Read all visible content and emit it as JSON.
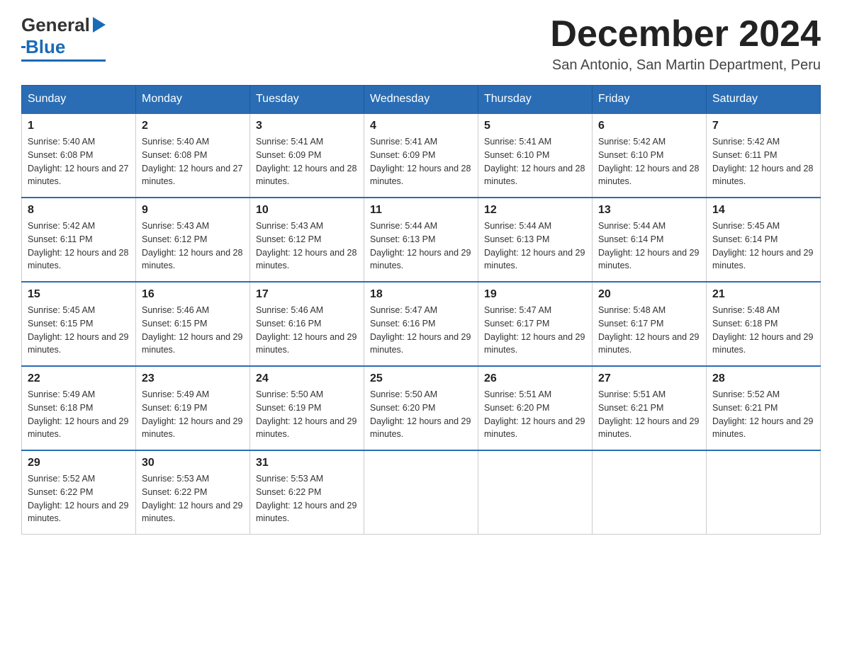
{
  "header": {
    "logo": {
      "general": "General",
      "blue": "Blue"
    },
    "title": "December 2024",
    "location": "San Antonio, San Martin Department, Peru"
  },
  "calendar": {
    "days_of_week": [
      "Sunday",
      "Monday",
      "Tuesday",
      "Wednesday",
      "Thursday",
      "Friday",
      "Saturday"
    ],
    "weeks": [
      [
        {
          "day": "1",
          "sunrise": "Sunrise: 5:40 AM",
          "sunset": "Sunset: 6:08 PM",
          "daylight": "Daylight: 12 hours and 27 minutes."
        },
        {
          "day": "2",
          "sunrise": "Sunrise: 5:40 AM",
          "sunset": "Sunset: 6:08 PM",
          "daylight": "Daylight: 12 hours and 27 minutes."
        },
        {
          "day": "3",
          "sunrise": "Sunrise: 5:41 AM",
          "sunset": "Sunset: 6:09 PM",
          "daylight": "Daylight: 12 hours and 28 minutes."
        },
        {
          "day": "4",
          "sunrise": "Sunrise: 5:41 AM",
          "sunset": "Sunset: 6:09 PM",
          "daylight": "Daylight: 12 hours and 28 minutes."
        },
        {
          "day": "5",
          "sunrise": "Sunrise: 5:41 AM",
          "sunset": "Sunset: 6:10 PM",
          "daylight": "Daylight: 12 hours and 28 minutes."
        },
        {
          "day": "6",
          "sunrise": "Sunrise: 5:42 AM",
          "sunset": "Sunset: 6:10 PM",
          "daylight": "Daylight: 12 hours and 28 minutes."
        },
        {
          "day": "7",
          "sunrise": "Sunrise: 5:42 AM",
          "sunset": "Sunset: 6:11 PM",
          "daylight": "Daylight: 12 hours and 28 minutes."
        }
      ],
      [
        {
          "day": "8",
          "sunrise": "Sunrise: 5:42 AM",
          "sunset": "Sunset: 6:11 PM",
          "daylight": "Daylight: 12 hours and 28 minutes."
        },
        {
          "day": "9",
          "sunrise": "Sunrise: 5:43 AM",
          "sunset": "Sunset: 6:12 PM",
          "daylight": "Daylight: 12 hours and 28 minutes."
        },
        {
          "day": "10",
          "sunrise": "Sunrise: 5:43 AM",
          "sunset": "Sunset: 6:12 PM",
          "daylight": "Daylight: 12 hours and 28 minutes."
        },
        {
          "day": "11",
          "sunrise": "Sunrise: 5:44 AM",
          "sunset": "Sunset: 6:13 PM",
          "daylight": "Daylight: 12 hours and 29 minutes."
        },
        {
          "day": "12",
          "sunrise": "Sunrise: 5:44 AM",
          "sunset": "Sunset: 6:13 PM",
          "daylight": "Daylight: 12 hours and 29 minutes."
        },
        {
          "day": "13",
          "sunrise": "Sunrise: 5:44 AM",
          "sunset": "Sunset: 6:14 PM",
          "daylight": "Daylight: 12 hours and 29 minutes."
        },
        {
          "day": "14",
          "sunrise": "Sunrise: 5:45 AM",
          "sunset": "Sunset: 6:14 PM",
          "daylight": "Daylight: 12 hours and 29 minutes."
        }
      ],
      [
        {
          "day": "15",
          "sunrise": "Sunrise: 5:45 AM",
          "sunset": "Sunset: 6:15 PM",
          "daylight": "Daylight: 12 hours and 29 minutes."
        },
        {
          "day": "16",
          "sunrise": "Sunrise: 5:46 AM",
          "sunset": "Sunset: 6:15 PM",
          "daylight": "Daylight: 12 hours and 29 minutes."
        },
        {
          "day": "17",
          "sunrise": "Sunrise: 5:46 AM",
          "sunset": "Sunset: 6:16 PM",
          "daylight": "Daylight: 12 hours and 29 minutes."
        },
        {
          "day": "18",
          "sunrise": "Sunrise: 5:47 AM",
          "sunset": "Sunset: 6:16 PM",
          "daylight": "Daylight: 12 hours and 29 minutes."
        },
        {
          "day": "19",
          "sunrise": "Sunrise: 5:47 AM",
          "sunset": "Sunset: 6:17 PM",
          "daylight": "Daylight: 12 hours and 29 minutes."
        },
        {
          "day": "20",
          "sunrise": "Sunrise: 5:48 AM",
          "sunset": "Sunset: 6:17 PM",
          "daylight": "Daylight: 12 hours and 29 minutes."
        },
        {
          "day": "21",
          "sunrise": "Sunrise: 5:48 AM",
          "sunset": "Sunset: 6:18 PM",
          "daylight": "Daylight: 12 hours and 29 minutes."
        }
      ],
      [
        {
          "day": "22",
          "sunrise": "Sunrise: 5:49 AM",
          "sunset": "Sunset: 6:18 PM",
          "daylight": "Daylight: 12 hours and 29 minutes."
        },
        {
          "day": "23",
          "sunrise": "Sunrise: 5:49 AM",
          "sunset": "Sunset: 6:19 PM",
          "daylight": "Daylight: 12 hours and 29 minutes."
        },
        {
          "day": "24",
          "sunrise": "Sunrise: 5:50 AM",
          "sunset": "Sunset: 6:19 PM",
          "daylight": "Daylight: 12 hours and 29 minutes."
        },
        {
          "day": "25",
          "sunrise": "Sunrise: 5:50 AM",
          "sunset": "Sunset: 6:20 PM",
          "daylight": "Daylight: 12 hours and 29 minutes."
        },
        {
          "day": "26",
          "sunrise": "Sunrise: 5:51 AM",
          "sunset": "Sunset: 6:20 PM",
          "daylight": "Daylight: 12 hours and 29 minutes."
        },
        {
          "day": "27",
          "sunrise": "Sunrise: 5:51 AM",
          "sunset": "Sunset: 6:21 PM",
          "daylight": "Daylight: 12 hours and 29 minutes."
        },
        {
          "day": "28",
          "sunrise": "Sunrise: 5:52 AM",
          "sunset": "Sunset: 6:21 PM",
          "daylight": "Daylight: 12 hours and 29 minutes."
        }
      ],
      [
        {
          "day": "29",
          "sunrise": "Sunrise: 5:52 AM",
          "sunset": "Sunset: 6:22 PM",
          "daylight": "Daylight: 12 hours and 29 minutes."
        },
        {
          "day": "30",
          "sunrise": "Sunrise: 5:53 AM",
          "sunset": "Sunset: 6:22 PM",
          "daylight": "Daylight: 12 hours and 29 minutes."
        },
        {
          "day": "31",
          "sunrise": "Sunrise: 5:53 AM",
          "sunset": "Sunset: 6:22 PM",
          "daylight": "Daylight: 12 hours and 29 minutes."
        },
        null,
        null,
        null,
        null
      ]
    ]
  }
}
